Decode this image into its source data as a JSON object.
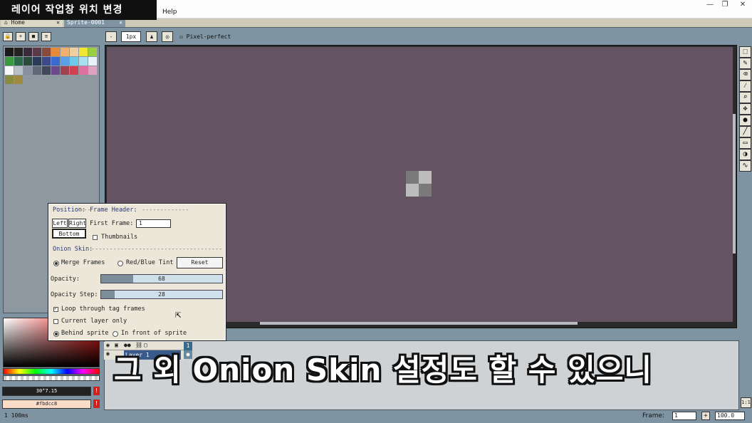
{
  "overlay_title": "레이어 작업창 위치 변경",
  "menu": {
    "help": "Help"
  },
  "window_controls": {
    "minimize": "—",
    "restore": "❐",
    "close": "✕"
  },
  "tabs": [
    {
      "label": "Home"
    },
    {
      "label": "Sprite-0001"
    }
  ],
  "left_toolbar": {
    "buttons": [
      "🔒",
      "+",
      "■",
      "≡"
    ]
  },
  "palette_colors": [
    "#1a1a1a",
    "#262222",
    "#3b2a3a",
    "#5c3a4a",
    "#8a4a3a",
    "#e88a3a",
    "#f0b070",
    "#f0d0a0",
    "#f0e830",
    "#9ad040",
    "#3a9a40",
    "#2a6a48",
    "#2a4a3a",
    "#2a3a5a",
    "#3a4a8a",
    "#3a6ad0",
    "#5aa0e8",
    "#70c8e8",
    "#a8e0f0",
    "#e8f0f8",
    "#f8f8f8",
    "#b8c0c8",
    "#8890a0",
    "#606878",
    "#40485a",
    "#6a4a8a",
    "#a04050",
    "#d04050",
    "#e070a0",
    "#e0a0c0",
    "#8a8a40",
    "#a08a40"
  ],
  "color_bar": {
    "foreground": "30°7.15",
    "background": "#fbdcc8"
  },
  "context_bar": {
    "brush_size": "1px",
    "pixel_perfect": "Pixel-perfect"
  },
  "onion_skin": {
    "position_label": "Position:",
    "frame_header_label": "Frame Header:",
    "left": "Left",
    "right": "Right",
    "bottom": "Bottom",
    "first_frame_label": "First Frame:",
    "first_frame_value": "1",
    "thumbnails_label": "Thumbnails",
    "thumbnails_checked": false,
    "onion_skin_label": "Onion Skin:",
    "merge_frames": "Merge Frames",
    "red_blue_tint": "Red/Blue Tint",
    "reset": "Reset",
    "opacity_label": "Opacity:",
    "opacity_value": 68,
    "opacity_max": 255,
    "opacity_step_label": "Opacity Step:",
    "opacity_step_value": 28,
    "opacity_step_max": 255,
    "loop_through_tag_frames": "Loop through tag frames",
    "loop_checked": true,
    "current_layer_only": "Current layer only",
    "current_layer_checked": false,
    "behind_sprite": "Behind sprite",
    "in_front_of_sprite": "In front of sprite"
  },
  "timeline": {
    "layer_name": "Layer 1",
    "frame_number": "1"
  },
  "caption": "그 외 Onion Skin 설정도 할 수 있으니",
  "status_bar": {
    "left": "1  100ms",
    "frame_label": "Frame:",
    "frame_value": "1",
    "zoom": "100.0"
  },
  "right_tools": [
    "marquee-icon",
    "pencil-icon",
    "eraser-icon",
    "eyedropper-icon",
    "zoom-icon",
    "move-icon",
    "bucket-icon",
    "line-icon",
    "rectangle-icon",
    "ellipse-icon",
    "blur-icon"
  ]
}
